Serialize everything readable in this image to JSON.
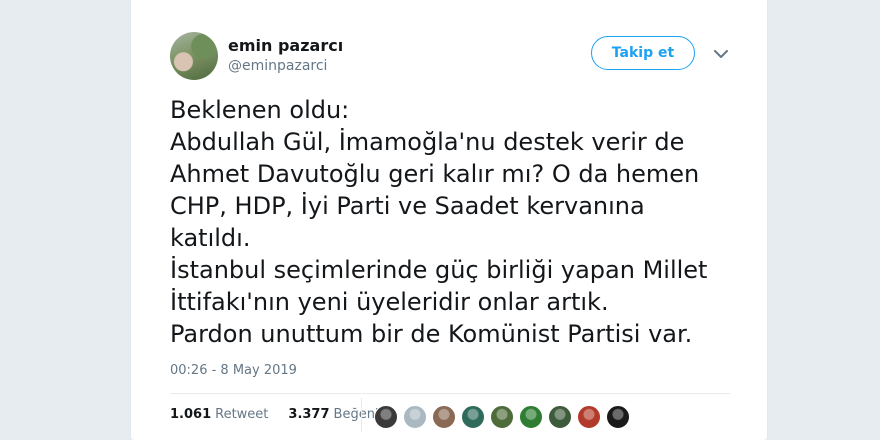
{
  "user": {
    "name": "emin pazarcı",
    "handle": "@eminpazarci"
  },
  "follow_label": "Takip et",
  "tweet": {
    "lines": [
      "Beklenen oldu:",
      "Abdullah Gül, İmamoğla'nu destek verir de",
      "Ahmet Davutoğlu geri kalır mı? O da hemen",
      "CHP, HDP, İyi Parti ve Saadet kervanına",
      "katıldı.",
      "İstanbul seçimlerinde güç birliği yapan Millet",
      "İttifakı'nın yeni üyeleridir onlar artık.",
      "Pardon unuttum bir de Komünist Partisi var."
    ]
  },
  "timestamp": "00:26 - 8 May 2019",
  "stats": {
    "retweet_count": "1.061",
    "retweet_label": "Retweet",
    "like_count": "3.377",
    "like_label": "Beğeni"
  },
  "likers": [
    {
      "icon": "liker-avatar-1",
      "color": "#3a3a3a"
    },
    {
      "icon": "liker-avatar-2",
      "color": "#aab8c2"
    },
    {
      "icon": "liker-avatar-3",
      "color": "#8a6a55"
    },
    {
      "icon": "liker-avatar-4",
      "color": "#2f6b5a"
    },
    {
      "icon": "liker-avatar-5",
      "color": "#4e6b3a"
    },
    {
      "icon": "liker-avatar-6",
      "color": "#2e7d32"
    },
    {
      "icon": "liker-avatar-7",
      "color": "#3d5a3a"
    },
    {
      "icon": "liker-avatar-8",
      "color": "#b23a2a"
    },
    {
      "icon": "liker-avatar-9",
      "color": "#1a1a1a"
    }
  ],
  "colors": {
    "accent": "#1da1f2",
    "text": "#14171a",
    "muted": "#657786",
    "background": "#e6ecf0"
  }
}
